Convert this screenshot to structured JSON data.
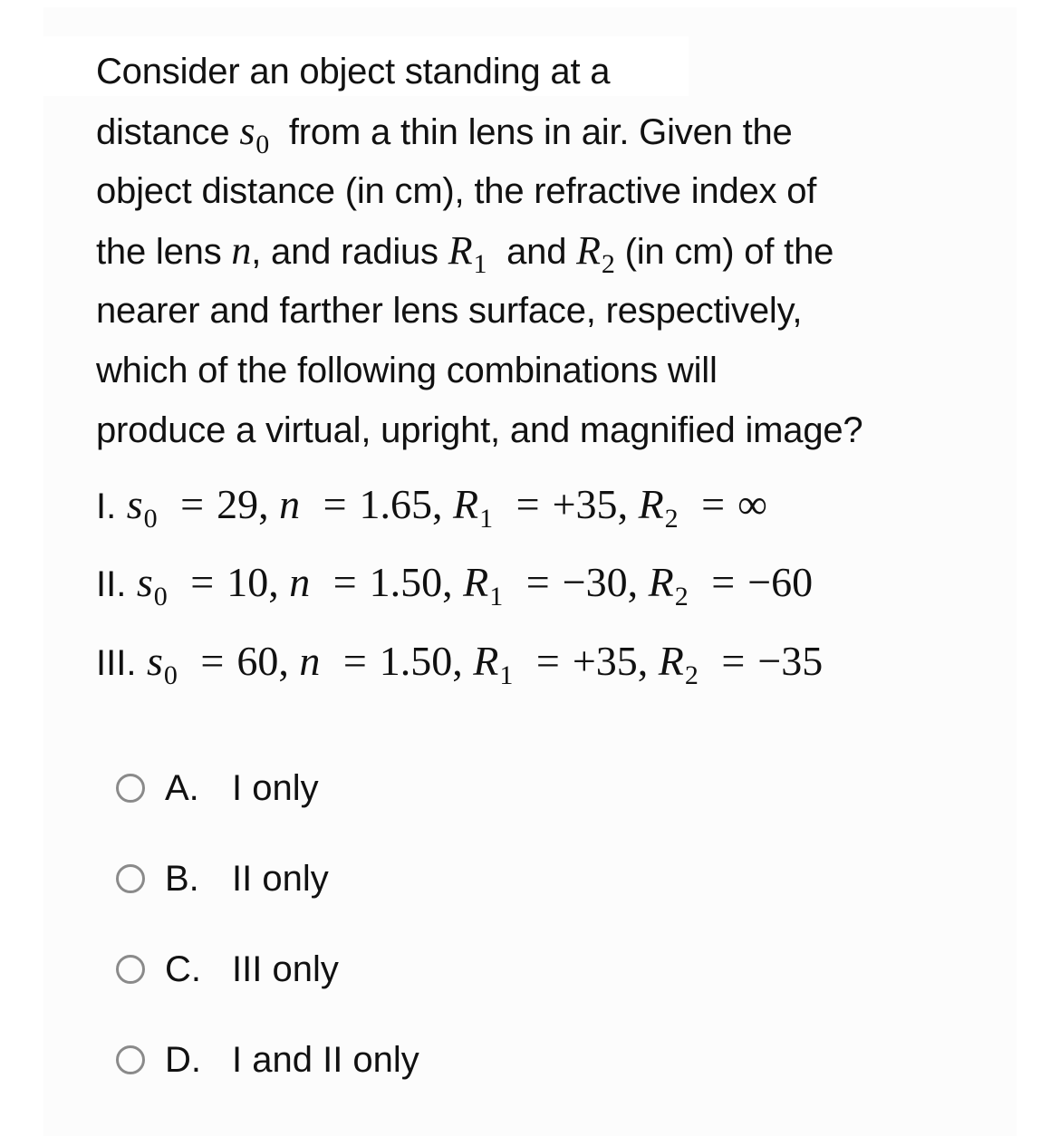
{
  "question": {
    "lines": [
      "Consider an object standing at a",
      [
        "distance ",
        "s",
        "0",
        " from a thin lens in air. Given the"
      ],
      "object distance (in cm), the refractive index of",
      [
        "the lens ",
        "n",
        ", and radius ",
        "R",
        "1",
        " and ",
        "R",
        "2",
        " (in cm) of the"
      ],
      "nearer and farther lens surface, respectively,",
      "which of the following combinations will",
      "produce a virtual, upright, and magnified image?"
    ],
    "l2_pre": "distance ",
    "l2_var": "s",
    "l2_sub": "0",
    "l2_post": "from a thin lens in air. Given the",
    "l4_pre": "the lens ",
    "l4_n": "n",
    "l4_mid1": ", and radius ",
    "l4_R": "R",
    "l4_sub1": "1",
    "l4_mid2": "and ",
    "l4_sub2": "2",
    "l4_post": " (in cm) of the"
  },
  "combinations": [
    {
      "label": "I.",
      "s0": "29",
      "n": "1.65",
      "R1": "+35",
      "R2": "∞"
    },
    {
      "label": "II.",
      "s0": "10",
      "n": "1.50",
      "R1": "−30",
      "R2": "−60"
    },
    {
      "label": "III.",
      "s0": "60",
      "n": "1.50",
      "R1": "+35",
      "R2": "−35"
    }
  ],
  "symbols": {
    "s": "s",
    "zero": "0",
    "n": "n",
    "R": "R",
    "one": "1",
    "two": "2",
    "equals": "=",
    "comma": ","
  },
  "options": [
    {
      "letter": "A.",
      "text": "I only",
      "selected": false
    },
    {
      "letter": "B.",
      "text": "II only",
      "selected": false
    },
    {
      "letter": "C.",
      "text": "III only",
      "selected": false
    },
    {
      "letter": "D.",
      "text": "I and II only",
      "selected": false
    }
  ],
  "colors": {
    "text": "#111111",
    "radio_border": "#8a8a8a",
    "panel_bg": "#fcfcfc"
  }
}
